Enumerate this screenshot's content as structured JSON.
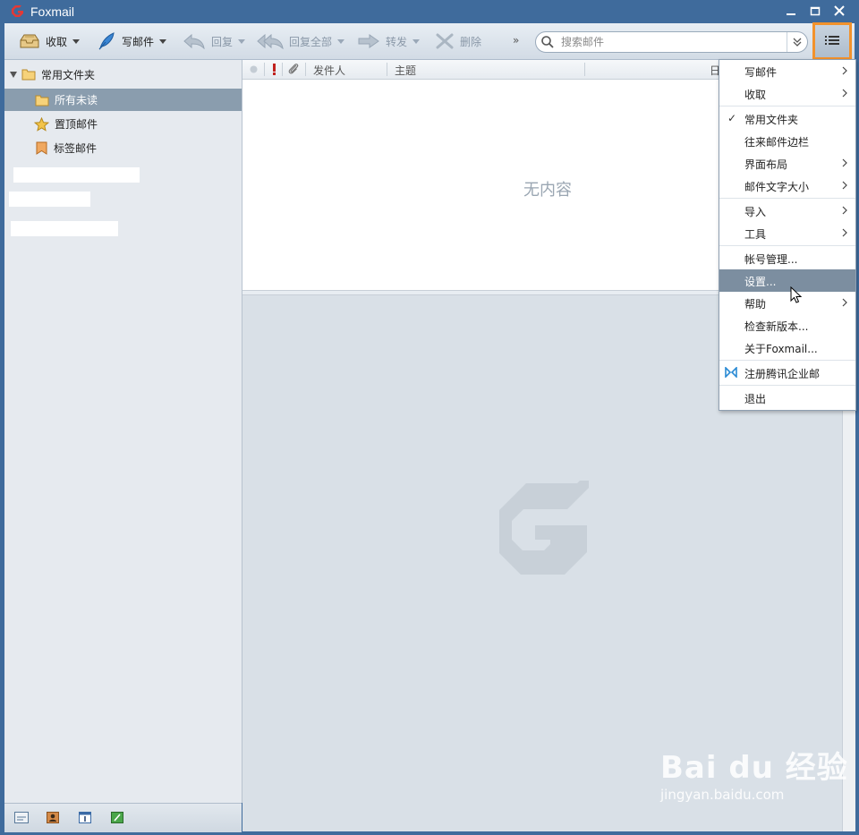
{
  "window": {
    "title": "Foxmail"
  },
  "toolbar": {
    "receive_label": "收取",
    "compose_label": "写邮件",
    "reply_label": "回复",
    "reply_all_label": "回复全部",
    "forward_label": "转发",
    "delete_label": "删除",
    "more_label": "»",
    "search_placeholder": "搜索邮件"
  },
  "sidebar": {
    "root_label": "常用文件夹",
    "items": [
      {
        "label": "所有未读",
        "icon": "folder-icon",
        "selected": true
      },
      {
        "label": "置顶邮件",
        "icon": "star-icon",
        "selected": false
      },
      {
        "label": "标签邮件",
        "icon": "tag-icon",
        "selected": false
      }
    ]
  },
  "mail_list": {
    "columns": [
      "发件人",
      "主题",
      "日"
    ],
    "empty_text": "无内容"
  },
  "dropdown_menu": {
    "items": [
      {
        "label": "写邮件",
        "submenu": true
      },
      {
        "label": "收取",
        "submenu": true
      },
      {
        "label": "常用文件夹",
        "checked": true
      },
      {
        "label": "往来邮件边栏"
      },
      {
        "label": "界面布局",
        "submenu": true
      },
      {
        "label": "邮件文字大小",
        "submenu": true
      },
      {
        "label": "导入",
        "submenu": true
      },
      {
        "label": "工具",
        "submenu": true
      },
      {
        "label": "帐号管理..."
      },
      {
        "label": "设置...",
        "hovered": true
      },
      {
        "label": "帮助",
        "submenu": true
      },
      {
        "label": "检查新版本..."
      },
      {
        "label": "关于Foxmail..."
      },
      {
        "label": "注册腾讯企业邮",
        "icon": "tencent-exmail-icon"
      },
      {
        "label": "退出"
      }
    ]
  },
  "watermark": {
    "main": "Bai du 经验",
    "sub": "jingyan.baidu.com"
  },
  "colors": {
    "title_bar": "#3f6b9c",
    "highlight_border": "#f2922c",
    "selected_item": "#8a9dae",
    "menu_hover": "#7c8ea0"
  }
}
